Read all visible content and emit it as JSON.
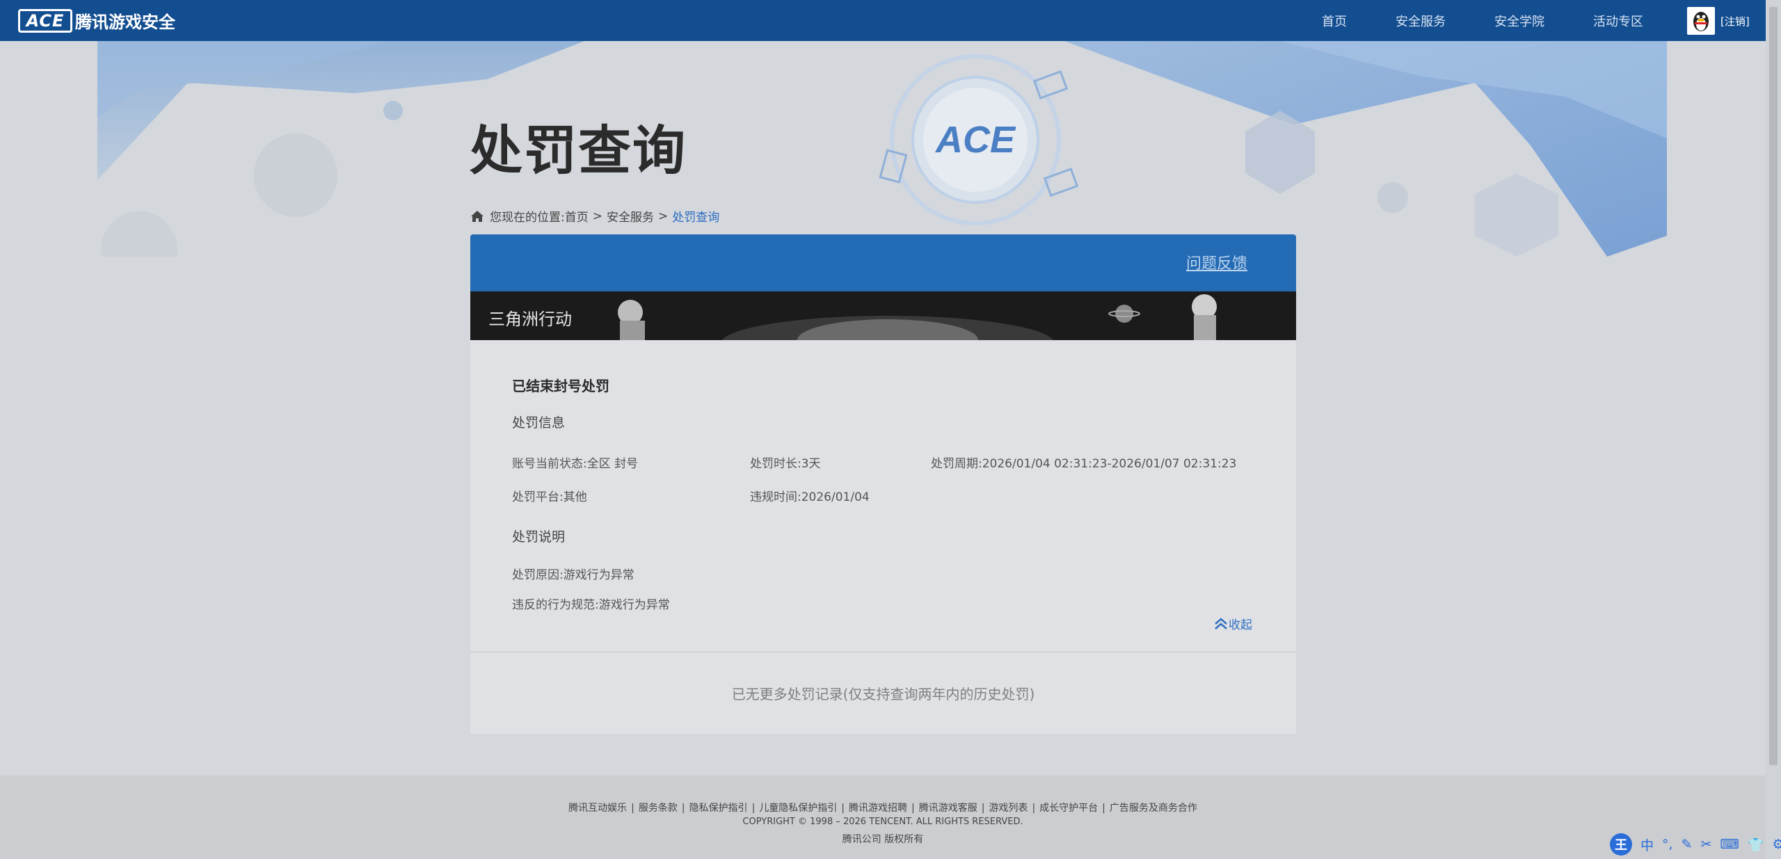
{
  "header": {
    "logo_mark": "ACE",
    "logo_text": "腾讯游戏安全",
    "nav": [
      "首页",
      "安全服务",
      "安全学院",
      "活动专区"
    ],
    "logout": "[注销]"
  },
  "page": {
    "title": "处罚查询",
    "breadcrumb": {
      "prefix": "您现在的位置:",
      "items": [
        "首页",
        "安全服务",
        "处罚查询"
      ],
      "sep": ">"
    }
  },
  "panel": {
    "feedback": "问题反馈",
    "game_name": "三角洲行动",
    "record_title": "已结束封号处罚",
    "info_label": "处罚信息",
    "fields": {
      "status": "账号当前状态:全区 封号",
      "duration": "处罚时长:3天",
      "period": "处罚周期:2026/01/04 02:31:23-2026/01/07 02:31:23",
      "platform": "处罚平台:其他",
      "violation_time": "违规时间:2026/01/04"
    },
    "desc_label": "处罚说明",
    "reason": "处罚原因:游戏行为异常",
    "rule": "违反的行为规范:游戏行为异常",
    "collapse": "收起",
    "no_more": "已无更多处罚记录(仅支持查询两年内的历史处罚)"
  },
  "footer": {
    "links": [
      "腾讯互动娱乐",
      "服务条款",
      "隐私保护指引",
      "儿童隐私保护指引",
      "腾讯游戏招聘",
      "腾讯游戏客服",
      "游戏列表",
      "成长守护平台",
      "广告服务及商务合作"
    ],
    "copyright": "COPYRIGHT © 1998 – 2026 TENCENT. ALL RIGHTS RESERVED.",
    "rights": "腾讯公司 版权所有"
  },
  "ime": {
    "logo": "王",
    "items": [
      "中",
      "°,",
      "✎",
      "✂",
      "⌨",
      "👕",
      "⚙"
    ]
  },
  "colors": {
    "nav_bg": "#134e91",
    "panel_header": "#246bb5",
    "accent": "#2a6cc0"
  }
}
